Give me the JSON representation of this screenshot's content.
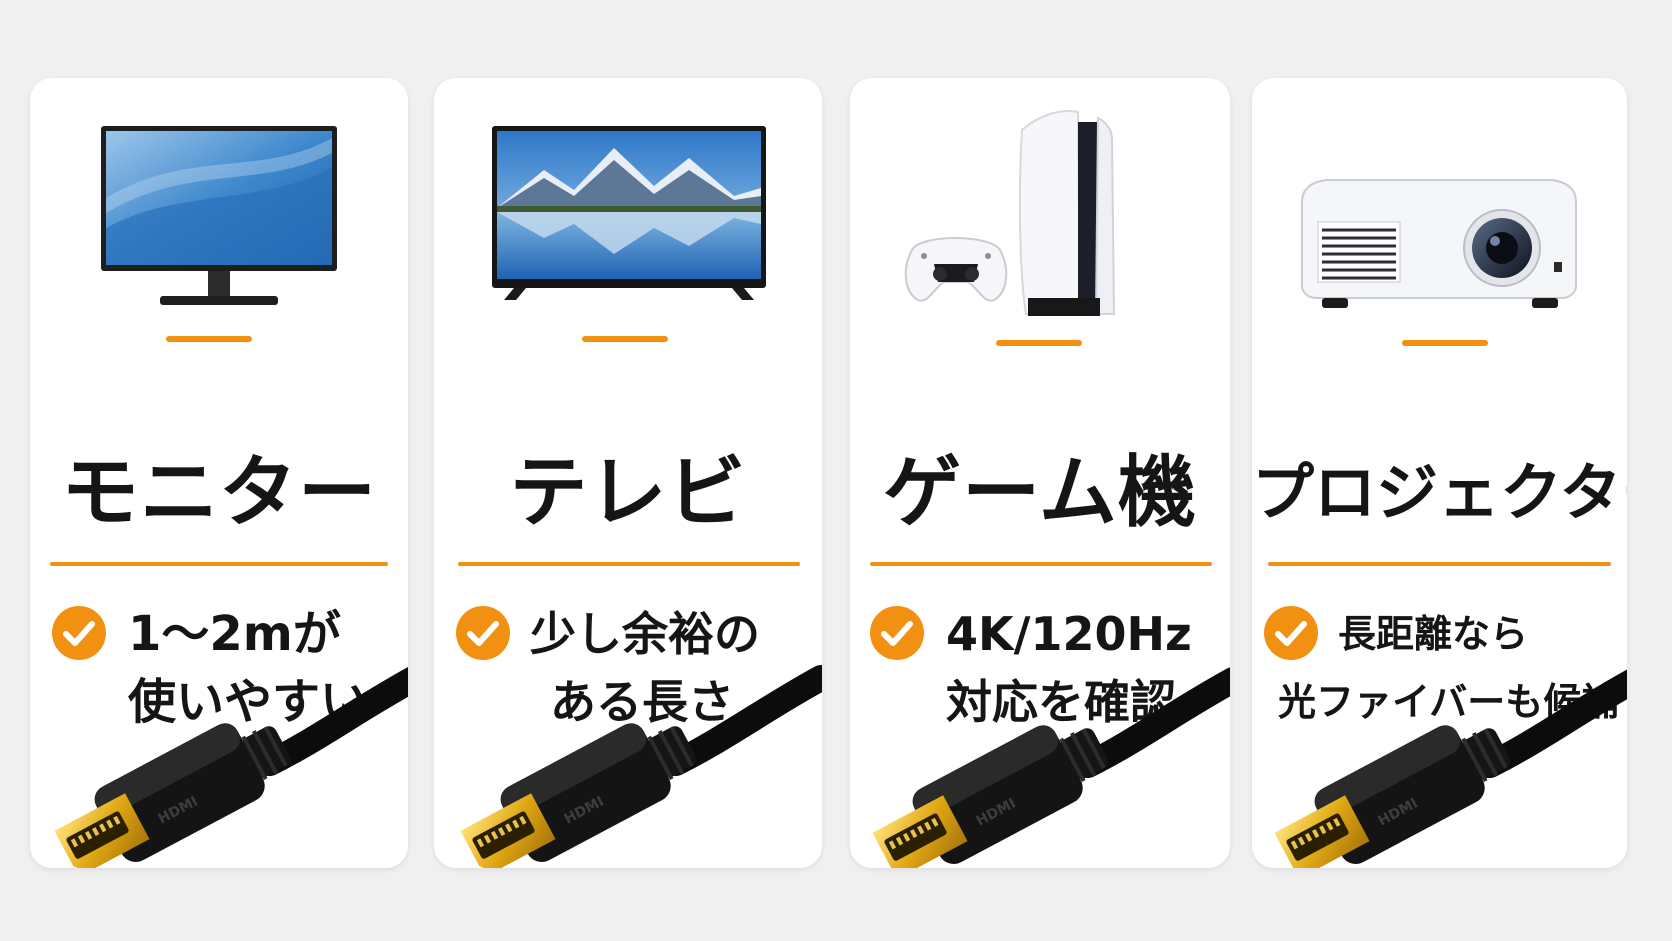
{
  "accent_color": "#f29111",
  "cards": [
    {
      "device_icon": "monitor-icon",
      "title": "モニター",
      "desc_line1": "1〜2mが",
      "desc_line2": "使いやすい",
      "cable_label": "HDMI"
    },
    {
      "device_icon": "tv-icon",
      "title": "テレビ",
      "desc_line1": "少し余裕の",
      "desc_line2": "ある長さ",
      "cable_label": "HDMI"
    },
    {
      "device_icon": "game-console-icon",
      "title": "ゲーム機",
      "desc_line1": "4K/120Hz",
      "desc_line2": "対応を確認",
      "cable_label": "HDMI"
    },
    {
      "device_icon": "projector-icon",
      "title": "プロジェクター",
      "desc_line1": "長距離なら",
      "desc_line2": "光ファイバーも候補",
      "cable_label": "HDMI"
    }
  ]
}
